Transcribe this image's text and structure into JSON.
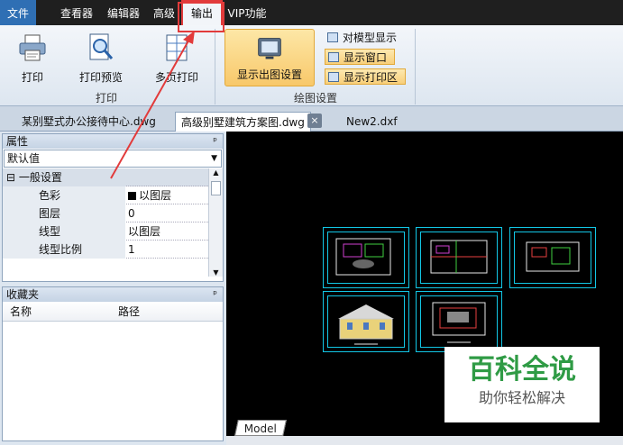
{
  "menubar": {
    "items": [
      "文件",
      "查看器",
      "编辑器",
      "高级",
      "输出",
      "VIP功能"
    ]
  },
  "ribbon": {
    "print": "打印",
    "print_preview": "打印预览",
    "multi_print": "多页打印",
    "print_group": "打印",
    "display_settings": "显示出图设置",
    "show_model": "对模型显示",
    "show_window": "显示窗口",
    "show_print_area": "显示打印区",
    "plot_group": "绘图设置"
  },
  "tabs": {
    "items": [
      "某别墅式办公接待中心.dwg",
      "高级别墅建筑方案图.dwg",
      "New2.dxf"
    ],
    "close": "×"
  },
  "properties": {
    "title": "属性",
    "pin": "ᵖ",
    "combo": "默认值",
    "section": "一般设置",
    "rows": [
      {
        "key": "色彩",
        "value": "以图层"
      },
      {
        "key": "图层",
        "value": "0"
      },
      {
        "key": "线型",
        "value": "以图层"
      },
      {
        "key": "线型比例",
        "value": "1"
      }
    ]
  },
  "favorites": {
    "title": "收藏夹",
    "pin": "ᵖ",
    "col_name": "名称",
    "col_path": "路径"
  },
  "canvas": {
    "model_tab": "Model",
    "background": "#000000",
    "drawing_color": "#12c7e6"
  },
  "watermark": {
    "title": "百科全说",
    "subtitle": "助你轻松解决"
  },
  "colors": {
    "highlight": "#e23b3b",
    "watermark_green": "#2f9b45"
  }
}
